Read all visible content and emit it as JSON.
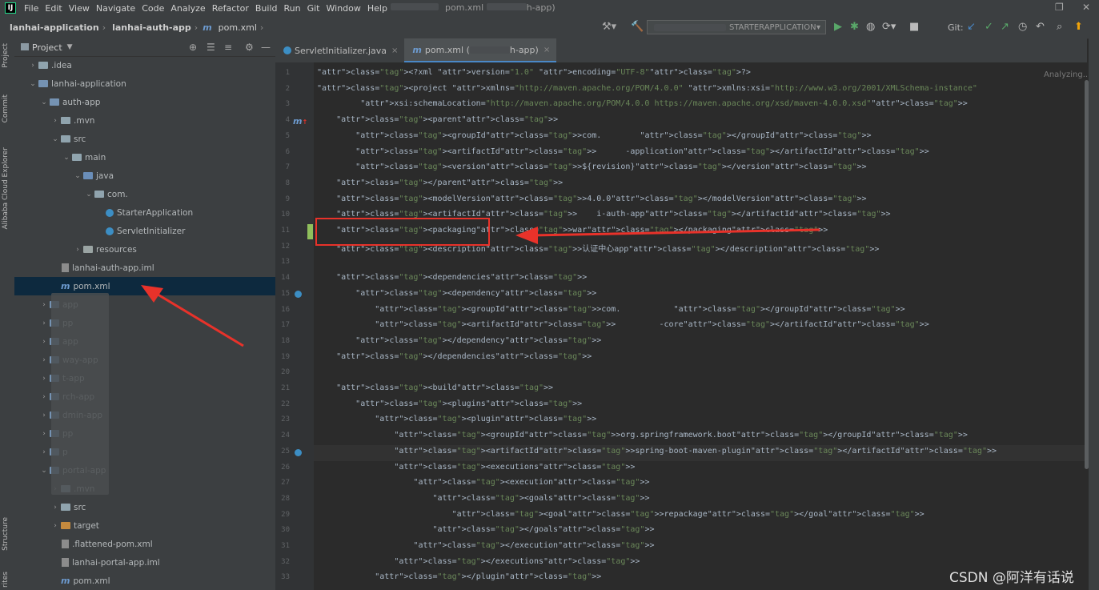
{
  "menu": {
    "logo": "IJ",
    "items": [
      "File",
      "Edit",
      "View",
      "Navigate",
      "Code",
      "Analyze",
      "Refactor",
      "Build",
      "Run",
      "Git",
      "Window",
      "Help"
    ],
    "window_title": "pom.xml",
    "window_title_suffix": "h-app)"
  },
  "breadcrumb": {
    "items": [
      "lanhai-application",
      "lanhai-auth-app",
      "pom.xml"
    ]
  },
  "run_config": {
    "label": "STARTERAPPLICATION"
  },
  "git": {
    "label": "Git:"
  },
  "sidebar": {
    "tabs": [
      "Project",
      "Commit",
      "Alibaba Cloud Explorer",
      "Structure",
      "rites"
    ]
  },
  "project": {
    "title": "Project",
    "tree": [
      {
        "label": ".idea",
        "icon": "folder",
        "indent": 1,
        "arrow": "right"
      },
      {
        "label": "lanhai-application",
        "icon": "folder-mod",
        "indent": 1,
        "arrow": "down"
      },
      {
        "label": "auth-app",
        "icon": "folder-mod",
        "indent": 2,
        "arrow": "down"
      },
      {
        "label": ".mvn",
        "icon": "folder",
        "indent": 3,
        "arrow": "right"
      },
      {
        "label": "src",
        "icon": "folder",
        "indent": 3,
        "arrow": "down"
      },
      {
        "label": "main",
        "icon": "folder",
        "indent": 4,
        "arrow": "down"
      },
      {
        "label": "java",
        "icon": "folder-src",
        "indent": 5,
        "arrow": "down"
      },
      {
        "label": "com.",
        "icon": "folder",
        "indent": 6,
        "arrow": "down"
      },
      {
        "label": "StarterApplication",
        "icon": "class",
        "indent": 7,
        "arrow": ""
      },
      {
        "label": "ServletInitializer",
        "icon": "class",
        "indent": 7,
        "arrow": ""
      },
      {
        "label": "resources",
        "icon": "folder-res",
        "indent": 5,
        "arrow": "right"
      },
      {
        "label": "lanhai-auth-app.iml",
        "icon": "file",
        "indent": 3,
        "arrow": ""
      },
      {
        "label": "pom.xml",
        "icon": "maven",
        "indent": 3,
        "arrow": "",
        "selected": true
      },
      {
        "label": "app",
        "icon": "folder-mod",
        "indent": 2,
        "arrow": "right"
      },
      {
        "label": "pp",
        "icon": "folder-mod",
        "indent": 2,
        "arrow": "right"
      },
      {
        "label": "app",
        "icon": "folder-mod",
        "indent": 2,
        "arrow": "right"
      },
      {
        "label": "way-app",
        "icon": "folder-mod",
        "indent": 2,
        "arrow": "right"
      },
      {
        "label": "t-app",
        "icon": "folder-mod",
        "indent": 2,
        "arrow": "right"
      },
      {
        "label": "rch-app",
        "icon": "folder-mod",
        "indent": 2,
        "arrow": "right"
      },
      {
        "label": "dmin-app",
        "icon": "folder-mod",
        "indent": 2,
        "arrow": "right"
      },
      {
        "label": "pp",
        "icon": "folder-mod",
        "indent": 2,
        "arrow": "right"
      },
      {
        "label": "p",
        "icon": "folder-mod",
        "indent": 2,
        "arrow": "right"
      },
      {
        "label": "portal-app",
        "icon": "folder-mod",
        "indent": 2,
        "arrow": "down"
      },
      {
        "label": ".mvn",
        "icon": "folder",
        "indent": 3,
        "arrow": "right"
      },
      {
        "label": "src",
        "icon": "folder",
        "indent": 3,
        "arrow": "right"
      },
      {
        "label": "target",
        "icon": "folder-tgt",
        "indent": 3,
        "arrow": "right"
      },
      {
        "label": ".flattened-pom.xml",
        "icon": "file",
        "indent": 3,
        "arrow": ""
      },
      {
        "label": "lanhai-portal-app.iml",
        "icon": "file",
        "indent": 3,
        "arrow": ""
      },
      {
        "label": "pom.xml",
        "icon": "maven",
        "indent": 3,
        "arrow": ""
      }
    ]
  },
  "tabs": [
    {
      "label": "ServletInitializer.java",
      "icon": "class",
      "active": false
    },
    {
      "label": "pom.xml (",
      "suffix": "h-app)",
      "icon": "maven",
      "active": true
    }
  ],
  "editor": {
    "status": "Analyzing...",
    "line_numbers": [
      "1",
      "2",
      "3",
      "4",
      "5",
      "6",
      "7",
      "8",
      "9",
      "10",
      "11",
      "12",
      "13",
      "14",
      "15",
      "16",
      "17",
      "18",
      "19",
      "20",
      "21",
      "22",
      "23",
      "24",
      "25",
      "26",
      "27",
      "28",
      "29",
      "30",
      "31",
      "32",
      "33"
    ],
    "lines": [
      "<?xml version=\"1.0\" encoding=\"UTF-8\"?>",
      "<project xmlns=\"http://maven.apache.org/POM/4.0.0\" xmlns:xsi=\"http://www.w3.org/2001/XMLSchema-instance\"",
      "         xsi:schemaLocation=\"http://maven.apache.org/POM/4.0.0 https://maven.apache.org/xsd/maven-4.0.0.xsd\">",
      "    <parent>",
      "        <groupId>com.        </groupId>",
      "        <artifactId>      -application</artifactId>",
      "        <version>${revision}</version>",
      "    </parent>",
      "    <modelVersion>4.0.0</modelVersion>",
      "    <artifactId>    i-auth-app</artifactId>",
      "    <packaging>war</packaging>",
      "    <description>认证中心app</description>",
      "",
      "    <dependencies>",
      "        <dependency>",
      "            <groupId>com.           </groupId>",
      "            <artifactId>         -core</artifactId>",
      "        </dependency>",
      "    </dependencies>",
      "",
      "    <build>",
      "        <plugins>",
      "            <plugin>",
      "                <groupId>org.springframework.boot</groupId>",
      "                <artifactId>spring-boot-maven-plugin</artifactId>",
      "                <executions>",
      "                    <execution>",
      "                        <goals>",
      "                            <goal>repackage</goal>",
      "                        </goals>",
      "                    </execution>",
      "                </executions>",
      "            </plugin>"
    ]
  },
  "watermark": "CSDN @阿洋有话说",
  "colors": {
    "annotation": "#e8322a",
    "accent": "#4a88c7"
  }
}
